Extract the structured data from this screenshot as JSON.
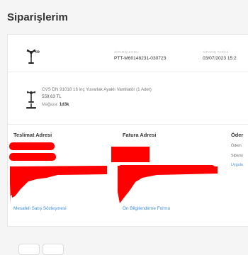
{
  "page": {
    "title": "Siparişlerim"
  },
  "order": {
    "code_label": "SİPARİŞ KODU",
    "code": "PTT-M60148231-030723",
    "date_label": "SİPARİŞ TARİHİ",
    "date": "03/07/2023 15:2"
  },
  "product": {
    "name": "CVS DN 91018 16 inç Yuvarlak Ayaklı Vantilatör (1 Adet)",
    "price": "559,63 TL",
    "store_label": "Mağaza:",
    "store": "1d3k"
  },
  "columns": {
    "delivery": "Teslimat Adresi",
    "invoice": "Fatura Adresi",
    "payment": "Öder"
  },
  "payment_side": {
    "line1": "Ödem",
    "line2": "Siparış",
    "line3": "Uygula"
  },
  "links": {
    "distance_contract": "Mesafeli Satış Sözleşmesi",
    "pre_info": "Ön Bilgilendirme Formu"
  },
  "colors": {
    "redaction": "#ff0000",
    "link": "#3e8ddd",
    "text": "#333333"
  },
  "icons": {
    "fan": "fan-icon",
    "arrow": "two-way-arrow-icon"
  }
}
